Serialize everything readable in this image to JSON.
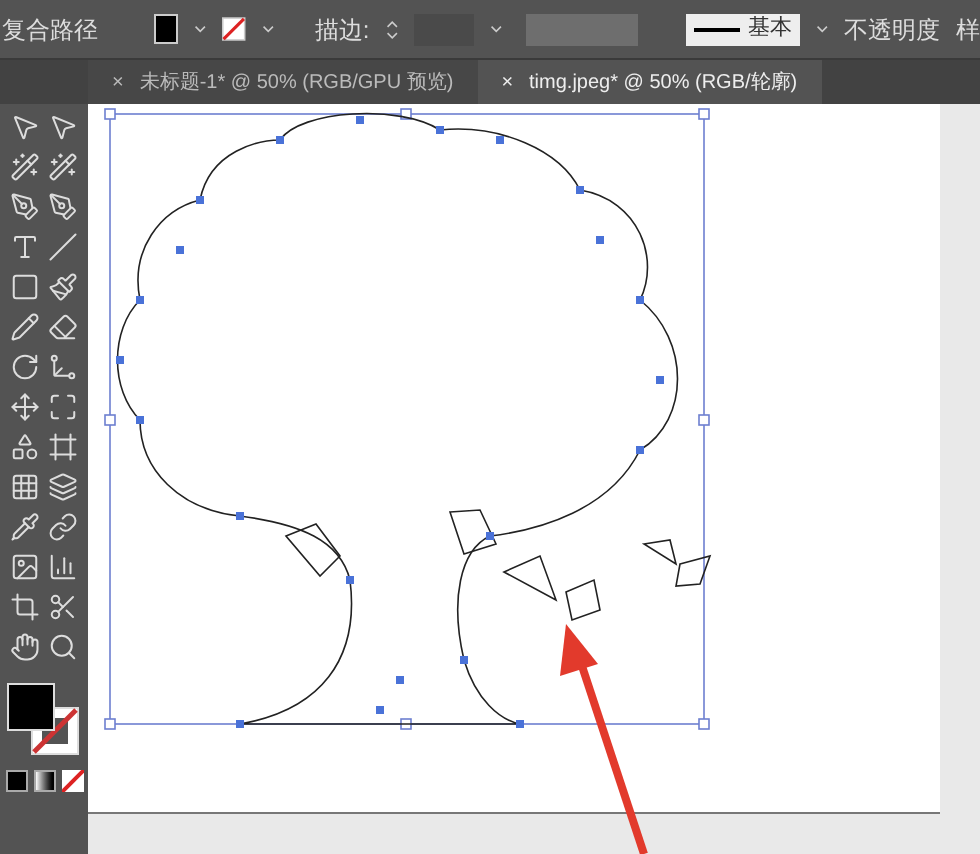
{
  "control_bar": {
    "object_type": "复合路径",
    "stroke_label": "描边:",
    "stroke_style": "基本",
    "opacity_label": "不透明度",
    "style_label": "样"
  },
  "tabs": [
    {
      "close": "×",
      "label": "未标题-1* @ 50% (RGB/GPU 预览)",
      "selected": false
    },
    {
      "close": "×",
      "label": "timg.jpeg* @ 50% (RGB/轮廓)",
      "selected": true
    }
  ]
}
